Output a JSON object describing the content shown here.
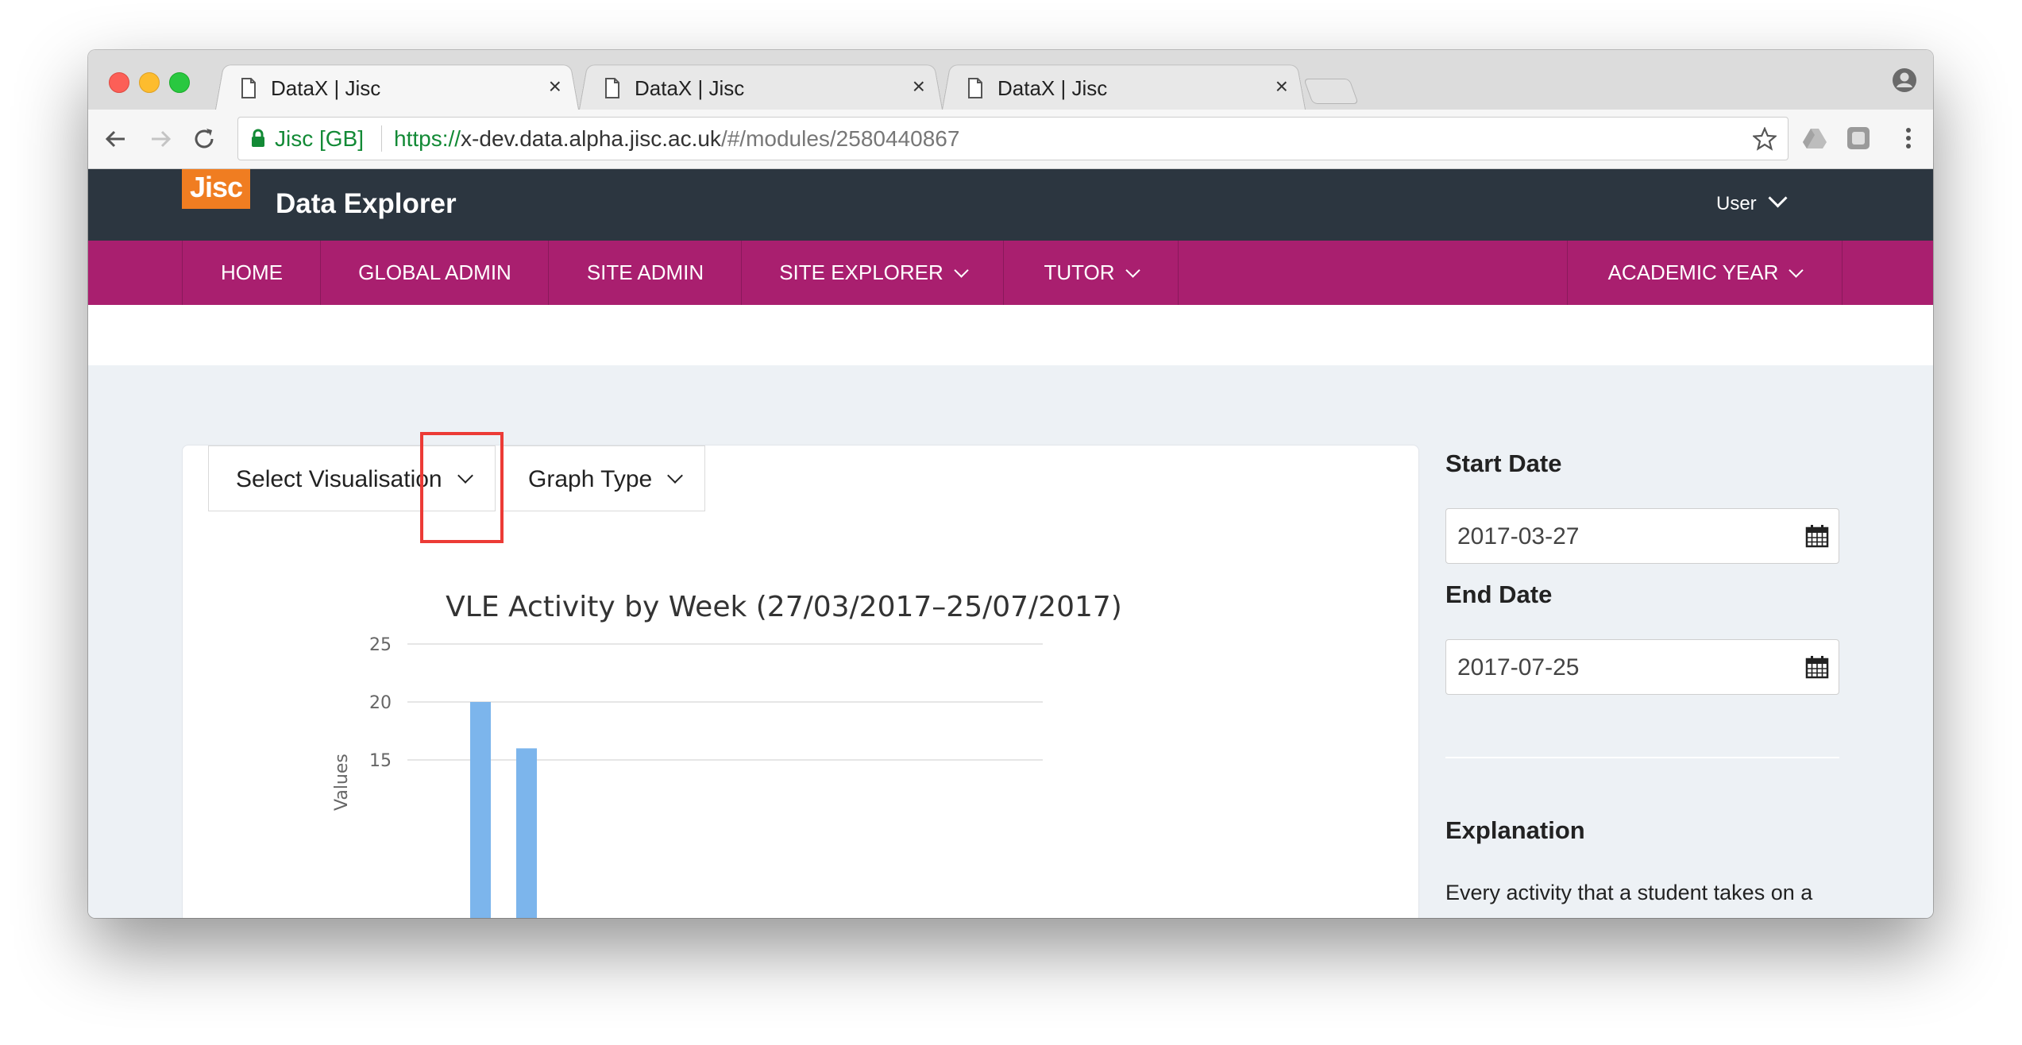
{
  "browser": {
    "tabs": [
      {
        "title": "DataX | Jisc",
        "active": true
      },
      {
        "title": "DataX | Jisc",
        "active": false
      },
      {
        "title": "DataX | Jisc",
        "active": false
      }
    ],
    "address_bar": {
      "security_label": "Jisc [GB]",
      "url_scheme": "https://",
      "url_host": "x-dev.data.alpha.jisc.ac.uk",
      "url_path": "/#/modules/2580440867"
    }
  },
  "header": {
    "logo_text": "Jisc",
    "app_title": "Data Explorer",
    "user_menu_label": "User"
  },
  "nav": {
    "items": [
      {
        "label": "HOME",
        "has_dropdown": false
      },
      {
        "label": "GLOBAL ADMIN",
        "has_dropdown": false
      },
      {
        "label": "SITE ADMIN",
        "has_dropdown": false
      },
      {
        "label": "SITE EXPLORER",
        "has_dropdown": true
      },
      {
        "label": "TUTOR",
        "has_dropdown": true
      }
    ],
    "right_item": {
      "label": "ACADEMIC YEAR",
      "has_dropdown": true
    }
  },
  "toolbar": {
    "select_visualisation_label": "Select Visualisation",
    "graph_type_label": "Graph Type"
  },
  "sidebar": {
    "start_date_label": "Start Date",
    "start_date_value": "2017-03-27",
    "end_date_label": "End Date",
    "end_date_value": "2017-07-25",
    "explanation_heading": "Explanation",
    "explanation_text": "Every activity that a student takes on a"
  },
  "colors": {
    "header_bg": "#2c3640",
    "nav_bg": "#a91f6f",
    "logo_bg": "#f07d21",
    "bar_color": "#7cb5ec",
    "highlight": "#ec3b36",
    "content_bg": "#edf1f5"
  },
  "chart_data": {
    "type": "bar",
    "title": "VLE Activity by Week (27/03/2017–25/07/2017)",
    "ylabel": "Values",
    "y_ticks": [
      25,
      20,
      15
    ],
    "ylim": [
      0,
      25
    ],
    "grid": true,
    "series": [
      {
        "values": [
          20,
          16
        ]
      }
    ]
  }
}
